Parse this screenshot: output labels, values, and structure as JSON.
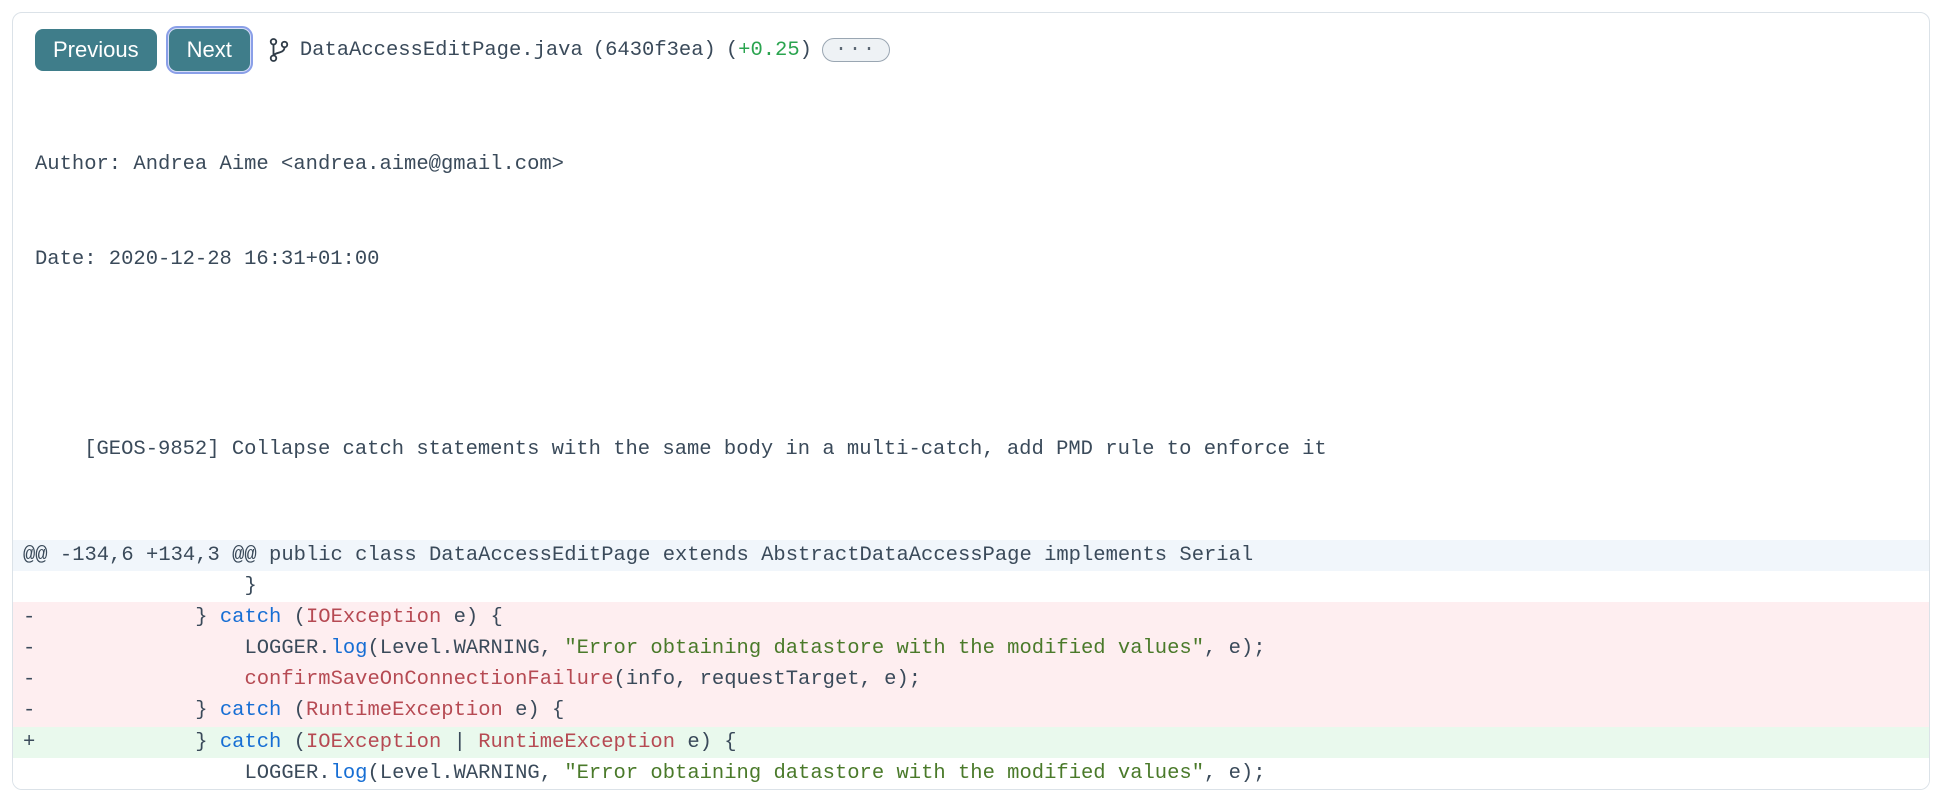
{
  "toolbar": {
    "prev_label": "Previous",
    "next_label": "Next",
    "filename": "DataAccessEditPage.java",
    "commit_hash": "6430f3ea",
    "delta_value": "+0.25",
    "more_label": "···"
  },
  "meta": {
    "author_line": "Author: Andrea Aime <andrea.aime@gmail.com>",
    "date_line": "Date: 2020-12-28 16:31+01:00",
    "message": "    [GEOS-9852] Collapse catch statements with the same body in a multi-catch, add PMD rule to enforce it"
  },
  "hunk_header": "@@ -134,6 +134,3 @@ public class DataAccessEditPage extends AbstractDataAccessPage implements Serial",
  "diff": {
    "lines": [
      {
        "type": "ctx",
        "text": "                 }"
      },
      {
        "type": "del",
        "tokens": [
          {
            "t": "plain",
            "v": "             } "
          },
          {
            "t": "kw",
            "v": "catch"
          },
          {
            "t": "plain",
            "v": " ("
          },
          {
            "t": "type",
            "v": "IOException"
          },
          {
            "t": "plain",
            "v": " e) {"
          }
        ]
      },
      {
        "type": "del",
        "tokens": [
          {
            "t": "plain",
            "v": "                 LOGGER."
          },
          {
            "t": "mem",
            "v": "log"
          },
          {
            "t": "plain",
            "v": "(Level.WARNING, "
          },
          {
            "t": "str",
            "v": "\"Error obtaining datastore with the modified values\""
          },
          {
            "t": "plain",
            "v": ", e);"
          }
        ]
      },
      {
        "type": "del",
        "tokens": [
          {
            "t": "plain",
            "v": "                 "
          },
          {
            "t": "type",
            "v": "confirmSaveOnConnectionFailure"
          },
          {
            "t": "plain",
            "v": "(info, requestTarget, e);"
          }
        ]
      },
      {
        "type": "del",
        "tokens": [
          {
            "t": "plain",
            "v": "             } "
          },
          {
            "t": "kw",
            "v": "catch"
          },
          {
            "t": "plain",
            "v": " ("
          },
          {
            "t": "type",
            "v": "RuntimeException"
          },
          {
            "t": "plain",
            "v": " e) {"
          }
        ]
      },
      {
        "type": "add",
        "tokens": [
          {
            "t": "plain",
            "v": "             } "
          },
          {
            "t": "kw",
            "v": "catch"
          },
          {
            "t": "plain",
            "v": " ("
          },
          {
            "t": "type",
            "v": "IOException"
          },
          {
            "t": "plain",
            "v": " | "
          },
          {
            "t": "type",
            "v": "RuntimeException"
          },
          {
            "t": "plain",
            "v": " e) {"
          }
        ]
      },
      {
        "type": "ctx",
        "tokens": [
          {
            "t": "plain",
            "v": "                 LOGGER."
          },
          {
            "t": "mem",
            "v": "log"
          },
          {
            "t": "plain",
            "v": "(Level.WARNING, "
          },
          {
            "t": "str",
            "v": "\"Error obtaining datastore with the modified values\""
          },
          {
            "t": "plain",
            "v": ", e);"
          }
        ]
      }
    ]
  }
}
